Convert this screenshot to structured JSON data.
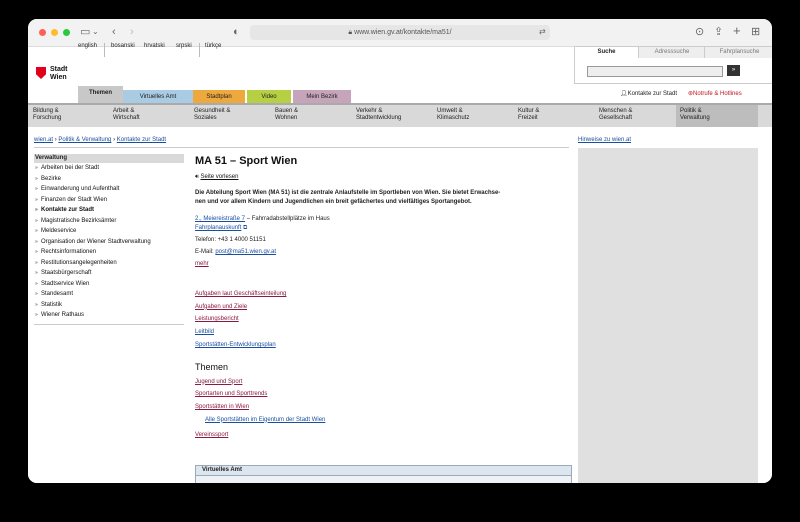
{
  "browser": {
    "url": "www.wien.gv.at/kontakte/ma51/"
  },
  "languages": [
    "english",
    "bosanski",
    "hrvatski",
    "srpski",
    "türkçe"
  ],
  "logo": {
    "line1": "Stadt",
    "line2": "Wien"
  },
  "search": {
    "tabs": [
      "Suche",
      "Adresssuche",
      "Fahrplansuche"
    ],
    "button": "»"
  },
  "theme_tabs": [
    "Themen",
    "Virtuelles Amt",
    "Stadtplan",
    "Video",
    "Mein Bezirk"
  ],
  "colors": {
    "themen": "#c8c8c8",
    "virtuelles_amt": "#a9cbe3",
    "stadtplan": "#eda93d",
    "video": "#b7cf43",
    "mein_bezirk": "#c6a5ba",
    "link": "#1a4fa0",
    "link_visited": "#8b1a3e",
    "logo_red": "#e2001a"
  },
  "header_links": {
    "kontakte": "Kontakte zur Stadt",
    "notrufe": "Notrufe & Hotlines"
  },
  "categories": [
    {
      "l1": "Bildung &",
      "l2": "Forschung"
    },
    {
      "l1": "Arbeit &",
      "l2": "Wirtschaft"
    },
    {
      "l1": "Gesundheit &",
      "l2": "Soziales"
    },
    {
      "l1": "Bauen &",
      "l2": "Wohnen"
    },
    {
      "l1": "Verkehr &",
      "l2": "Stadtentwicklung"
    },
    {
      "l1": "Umwelt &",
      "l2": "Klimaschutz"
    },
    {
      "l1": "Kultur &",
      "l2": "Freizeit"
    },
    {
      "l1": "Menschen &",
      "l2": "Gesellschaft"
    },
    {
      "l1": "Politik &",
      "l2": "Verwaltung"
    }
  ],
  "breadcrumb": [
    "wien.at",
    "Politik & Verwaltung",
    "Kontakte zur Stadt"
  ],
  "hint_link": "Hinweise zu wien.at",
  "nav": {
    "heading": "Verwaltung",
    "items": [
      "Arbeiten bei der Stadt",
      "Bezirke",
      "Einwanderung und Aufenthalt",
      "Finanzen der Stadt Wien",
      "Kontakte zur Stadt",
      "Magistratische Bezirksämter",
      "Meldeservice",
      "Organisation der Wiener Stadtverwaltung",
      "Rechtsinformationen",
      "Restitutionsangelegenheiten",
      "Staatsbürgerschaft",
      "Stadtservice Wien",
      "Standesamt",
      "Statistik",
      "Wiener Rathaus"
    ]
  },
  "main": {
    "title": "MA 51 – Sport Wien",
    "read_aloud": "Seite vorlesen",
    "intro_l1": "Die Abteilung Sport Wien (MA 51) ist die zentrale Anlaufstelle im Sportleben von Wien. Sie bietet Erwachse-",
    "intro_l2": "nen und vor allem Kindern und Jugendlichen ein breit gefächertes und vielfältiges Sportangebot.",
    "address_link": "2., Meiereistraße 7",
    "address_rest": " – Fahrradabstellplätze im Haus",
    "timetable": "Fahrplanauskunft",
    "phone": "Telefon: +43 1 4000 51151",
    "email_label": "E-Mail: ",
    "email": "post@ma51.wien.gv.at",
    "more": "mehr",
    "links": [
      "Aufgaben laut Geschäftseinteilung",
      "Aufgaben und Ziele",
      "Leistungsbericht",
      "Leitbild",
      "Sportstätten-Entwicklungsplan"
    ],
    "themen_heading": "Themen",
    "themen": [
      "Jugend und Sport",
      "Sportarten und Sporttrends",
      "Sportstätten in Wien",
      "Alle Sportstätten im Eigentum der Stadt Wien",
      "Vereinssport"
    ],
    "virtuelles_amt_box": "Virtuelles Amt"
  }
}
